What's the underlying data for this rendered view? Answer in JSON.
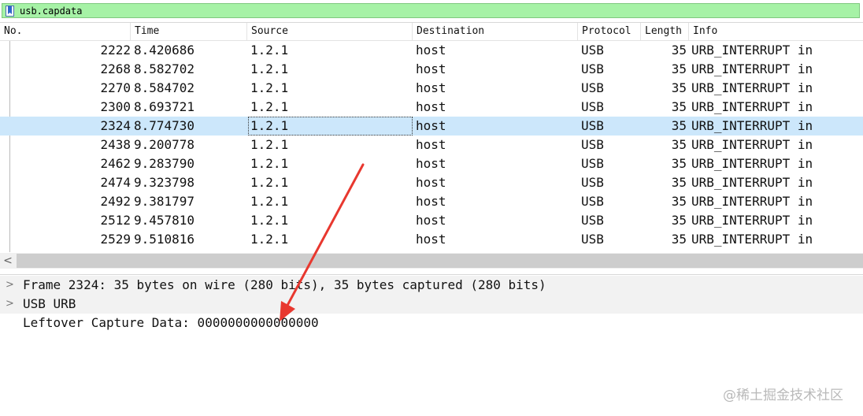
{
  "filter": {
    "value": "usb.capdata",
    "bookmark_icon": "bookmark-icon",
    "background": "#a6f2a6"
  },
  "columns": {
    "no": "No.",
    "time": "Time",
    "source": "Source",
    "destination": "Destination",
    "protocol": "Protocol",
    "length": "Length",
    "info": "Info"
  },
  "packets": [
    {
      "no": "2222",
      "time": "8.420686",
      "source": "1.2.1",
      "destination": "host",
      "protocol": "USB",
      "length": "35",
      "info": "URB_INTERRUPT in",
      "selected": false
    },
    {
      "no": "2268",
      "time": "8.582702",
      "source": "1.2.1",
      "destination": "host",
      "protocol": "USB",
      "length": "35",
      "info": "URB_INTERRUPT in",
      "selected": false
    },
    {
      "no": "2270",
      "time": "8.584702",
      "source": "1.2.1",
      "destination": "host",
      "protocol": "USB",
      "length": "35",
      "info": "URB_INTERRUPT in",
      "selected": false
    },
    {
      "no": "2300",
      "time": "8.693721",
      "source": "1.2.1",
      "destination": "host",
      "protocol": "USB",
      "length": "35",
      "info": "URB_INTERRUPT in",
      "selected": false
    },
    {
      "no": "2324",
      "time": "8.774730",
      "source": "1.2.1",
      "destination": "host",
      "protocol": "USB",
      "length": "35",
      "info": "URB_INTERRUPT in",
      "selected": true
    },
    {
      "no": "2438",
      "time": "9.200778",
      "source": "1.2.1",
      "destination": "host",
      "protocol": "USB",
      "length": "35",
      "info": "URB_INTERRUPT in",
      "selected": false
    },
    {
      "no": "2462",
      "time": "9.283790",
      "source": "1.2.1",
      "destination": "host",
      "protocol": "USB",
      "length": "35",
      "info": "URB_INTERRUPT in",
      "selected": false
    },
    {
      "no": "2474",
      "time": "9.323798",
      "source": "1.2.1",
      "destination": "host",
      "protocol": "USB",
      "length": "35",
      "info": "URB_INTERRUPT in",
      "selected": false
    },
    {
      "no": "2492",
      "time": "9.381797",
      "source": "1.2.1",
      "destination": "host",
      "protocol": "USB",
      "length": "35",
      "info": "URB_INTERRUPT in",
      "selected": false
    },
    {
      "no": "2512",
      "time": "9.457810",
      "source": "1.2.1",
      "destination": "host",
      "protocol": "USB",
      "length": "35",
      "info": "URB_INTERRUPT in",
      "selected": false
    },
    {
      "no": "2529",
      "time": "9.510816",
      "source": "1.2.1",
      "destination": "host",
      "protocol": "USB",
      "length": "35",
      "info": "URB_INTERRUPT in",
      "selected": false
    }
  ],
  "scrollbar": {
    "left_arrow": "<"
  },
  "details": [
    {
      "expander": ">",
      "text": "Frame 2324: 35 bytes on wire (280 bits), 35 bytes captured (280 bits)"
    },
    {
      "expander": ">",
      "text": "USB URB"
    },
    {
      "expander": "",
      "text": "Leftover Capture Data: 0000000000000000"
    }
  ],
  "watermark": "@稀土掘金技术社区",
  "colors": {
    "selected_row": "#cce7fb",
    "annotation_arrow": "#e8382f"
  }
}
